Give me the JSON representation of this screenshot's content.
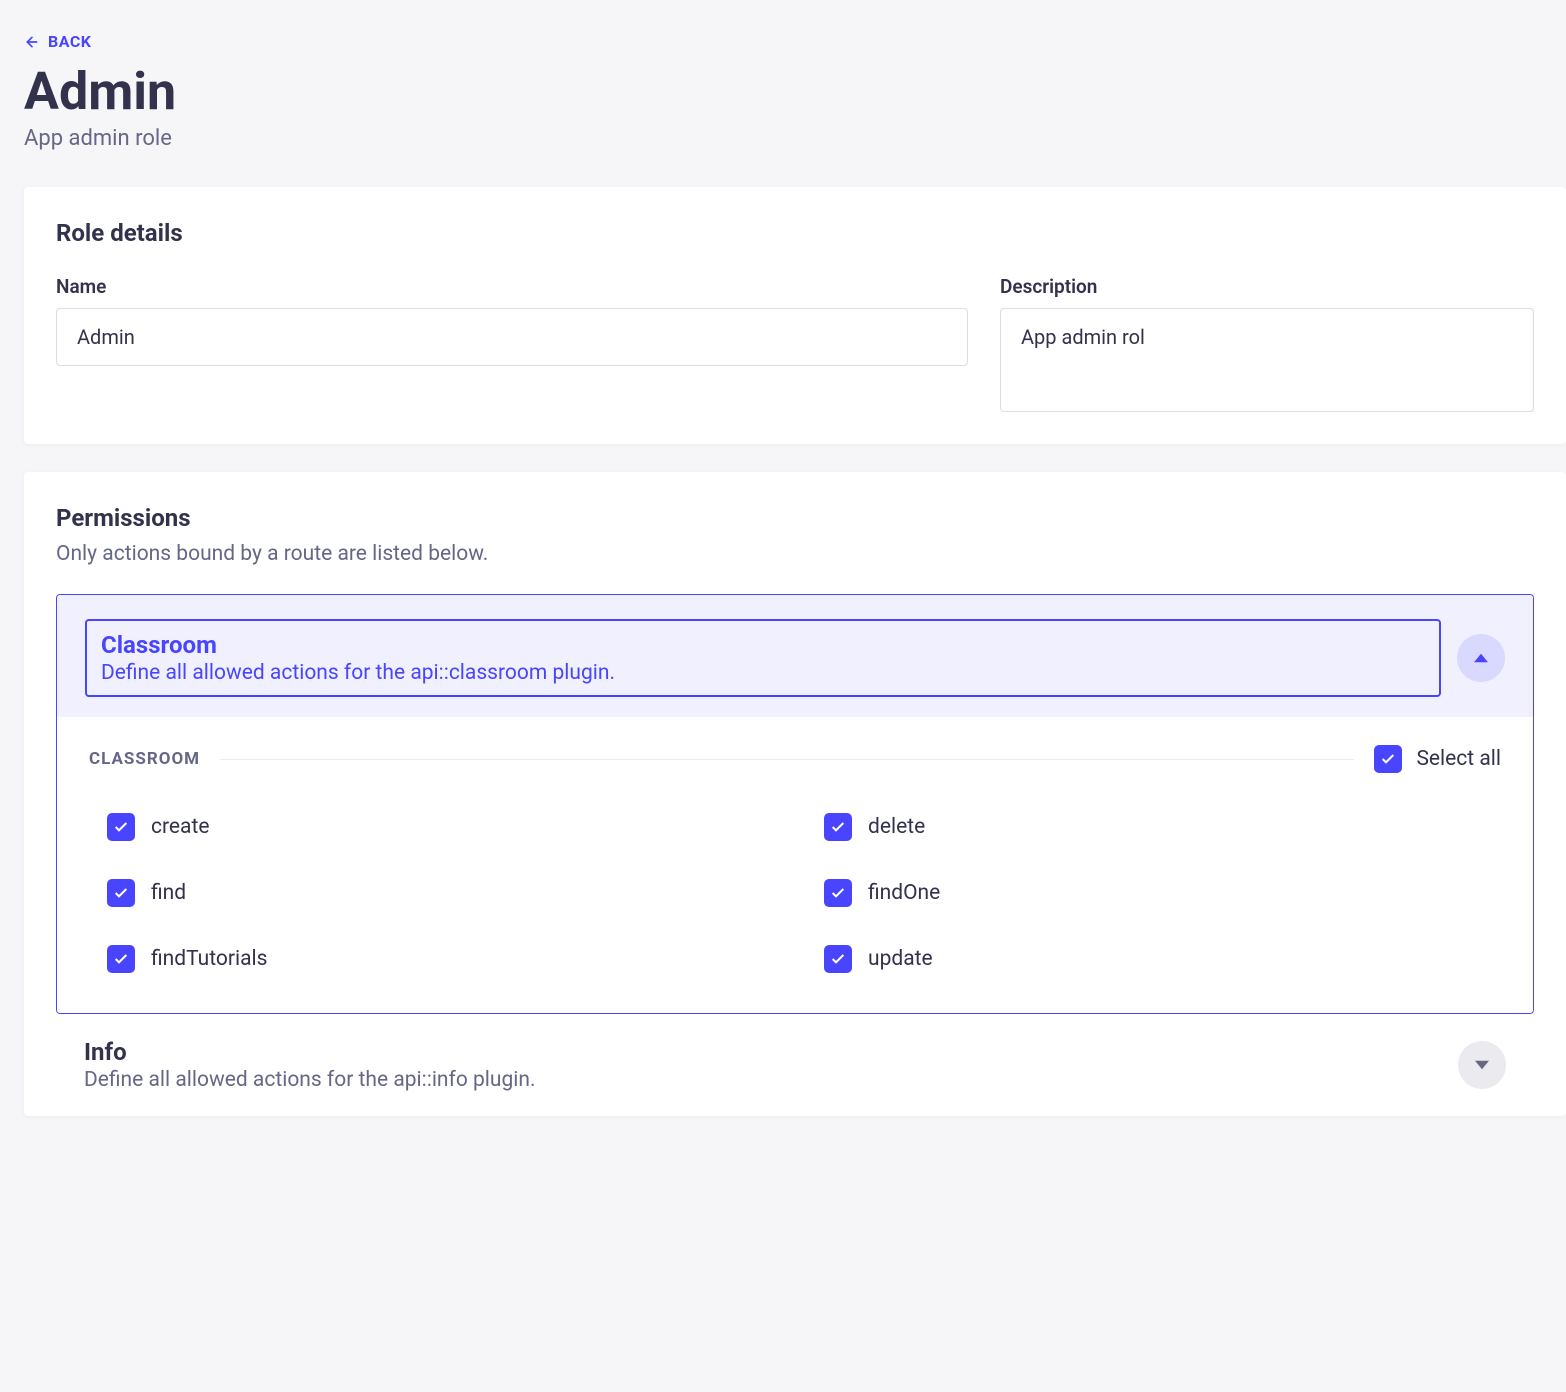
{
  "back_label": "BACK",
  "page": {
    "title": "Admin",
    "subtitle": "App admin role"
  },
  "role_details": {
    "heading": "Role details",
    "name_label": "Name",
    "name_value": "Admin",
    "description_label": "Description",
    "description_value": "App admin rol"
  },
  "permissions": {
    "heading": "Permissions",
    "subtitle": "Only actions bound by a route are listed below.",
    "sections": [
      {
        "title": "Classroom",
        "description": "Define all allowed actions for the api::classroom plugin.",
        "expanded": true,
        "group_label": "CLASSROOM",
        "select_all_label": "Select all",
        "select_all_checked": true,
        "actions": [
          {
            "label": "create",
            "checked": true
          },
          {
            "label": "delete",
            "checked": true
          },
          {
            "label": "find",
            "checked": true
          },
          {
            "label": "findOne",
            "checked": true
          },
          {
            "label": "findTutorials",
            "checked": true
          },
          {
            "label": "update",
            "checked": true
          }
        ]
      },
      {
        "title": "Info",
        "description": "Define all allowed actions for the api::info plugin.",
        "expanded": false
      }
    ]
  }
}
